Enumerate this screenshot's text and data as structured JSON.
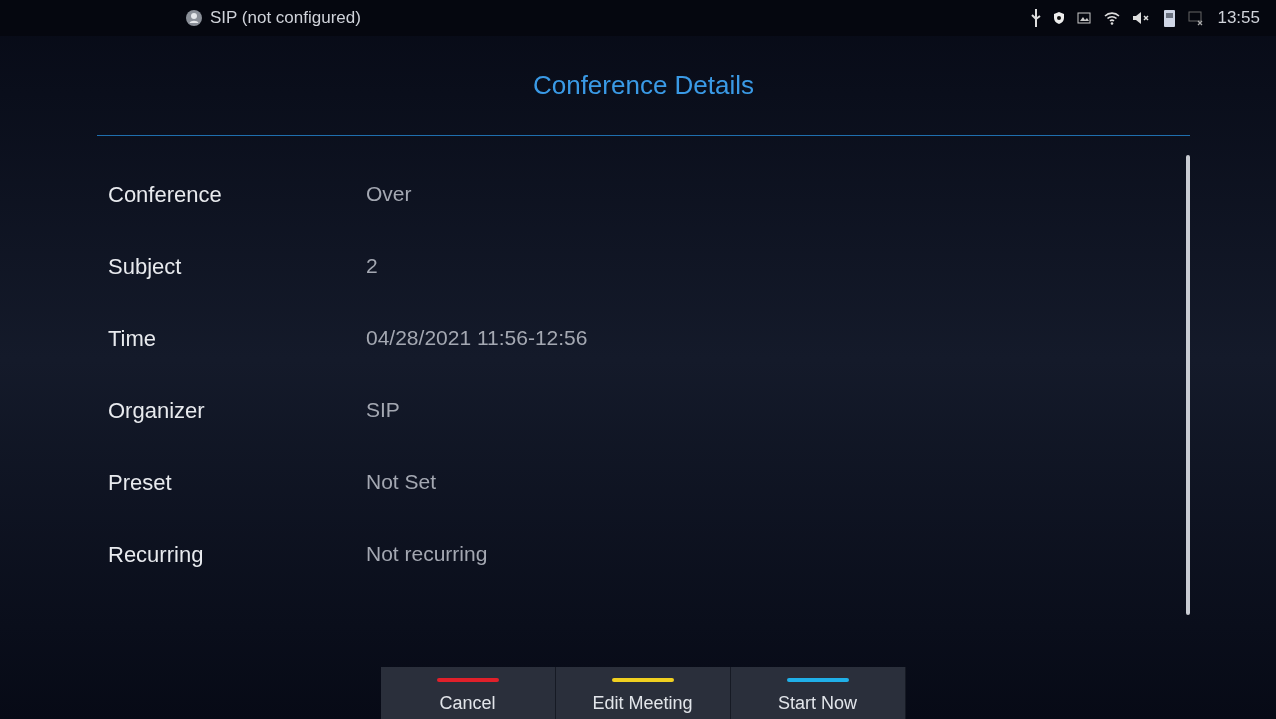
{
  "status_bar": {
    "account": "SIP (not configured)",
    "time": "13:55"
  },
  "title": "Conference Details",
  "details": [
    {
      "label": "Conference",
      "value": "Over"
    },
    {
      "label": "Subject",
      "value": "2"
    },
    {
      "label": "Time",
      "value": "04/28/2021 11:56-12:56"
    },
    {
      "label": "Organizer",
      "value": "SIP"
    },
    {
      "label": "Preset",
      "value": "Not Set"
    },
    {
      "label": "Recurring",
      "value": "Not recurring"
    }
  ],
  "buttons": [
    {
      "label": "Cancel",
      "color": "#e0202a"
    },
    {
      "label": "Edit Meeting",
      "color": "#f0d020"
    },
    {
      "label": "Start Now",
      "color": "#20b0e8"
    }
  ]
}
